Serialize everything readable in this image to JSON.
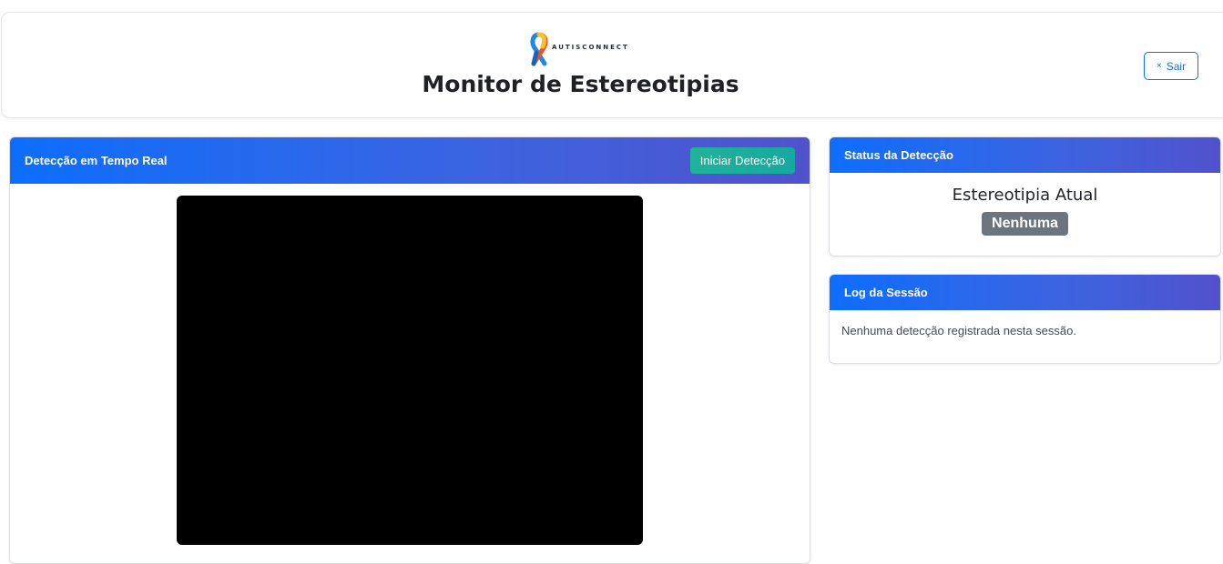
{
  "header": {
    "logo_text": "AUTISCONNECT",
    "title": "Monitor de Estereotipias",
    "exit_label": "Sair",
    "exit_icon": "×"
  },
  "video_panel": {
    "title": "Detecção em Tempo Real",
    "start_label": "Iniciar Detecção"
  },
  "status_panel": {
    "title": "Status da Detecção",
    "current_label": "Estereotipia Atual",
    "current_value": "Nenhuma"
  },
  "log_panel": {
    "title": "Log da Sessão",
    "empty_message": "Nenhuma detecção registrada nesta sessão."
  },
  "colors": {
    "primary": "#0d6efd",
    "gradient_end": "#5152cc",
    "start_button": "#1ab394",
    "badge": "#6c757d"
  }
}
